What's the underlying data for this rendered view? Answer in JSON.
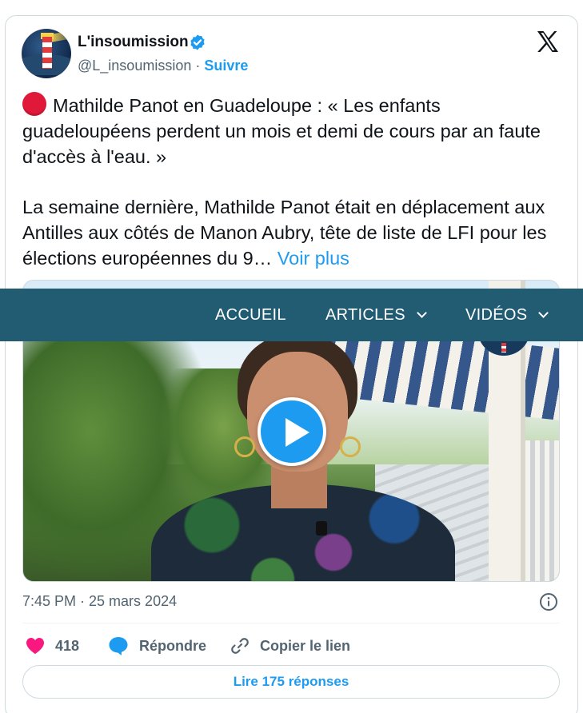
{
  "tweet": {
    "account_name": "L'insoumission",
    "handle": "@L_insoumission",
    "separator": "·",
    "follow_label": "Suivre",
    "verified": true,
    "text_line1": "Mathilde Panot en Guadeloupe : « Les enfants guadeloupéens perdent un mois et demi de cours par an faute d'accès à l'eau. »",
    "text_line2": "La semaine dernière, Mathilde Panot était en déplacement aux Antilles aux côtés de Manon Aubry, tête de liste de LFI pour les élections européennes du 9…",
    "see_more": "Voir plus",
    "timestamp": "7:45 PM · 25 mars 2024",
    "likes": "418",
    "reply_label": "Répondre",
    "copy_label": "Copier le lien",
    "read_replies": "Lire 175 réponses"
  },
  "site_nav": {
    "items": [
      {
        "label": "ACCUEIL",
        "dropdown": false
      },
      {
        "label": "ARTICLES",
        "dropdown": true
      },
      {
        "label": "VIDÉOS",
        "dropdown": true
      }
    ],
    "background": "#225c72"
  },
  "colors": {
    "accent": "#1d9bf0",
    "like": "#f91880",
    "red_dot": "#e0193a",
    "text_secondary": "#536471"
  },
  "icons": [
    "verified-badge-icon",
    "x-logo-icon",
    "red-circle-emoji-icon",
    "play-icon",
    "info-icon",
    "heart-icon",
    "reply-bubble-icon",
    "link-icon",
    "chevron-down-icon"
  ]
}
